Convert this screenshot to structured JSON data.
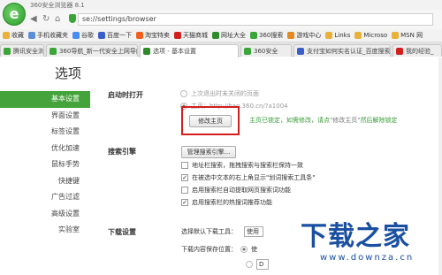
{
  "window": {
    "title": "360安全浏览器 8.1"
  },
  "address_bar": {
    "url": "se://settings/browser"
  },
  "bookmarks": [
    {
      "label": "收藏",
      "color": "#e9b13b"
    },
    {
      "label": "手机收藏夹",
      "color": "#5a8ed8"
    },
    {
      "label": "谷歌",
      "color": "#4a8df0"
    },
    {
      "label": "百度一下",
      "color": "#3a5fc8"
    },
    {
      "label": "淘宝特卖",
      "color": "#f06020"
    },
    {
      "label": "天猫商城",
      "color": "#d0201d"
    },
    {
      "label": "网址大全",
      "color": "#2f8a2c"
    },
    {
      "label": "360搜索",
      "color": "#3aa63a"
    },
    {
      "label": "游戏中心",
      "color": "#e08a20"
    },
    {
      "label": "Links",
      "color": "#e9b13b"
    },
    {
      "label": "Microso",
      "color": "#e9b13b"
    },
    {
      "label": "MSN 网",
      "color": "#e9b13b"
    }
  ],
  "tabs": [
    {
      "label": "腾讯安全浏览",
      "color": "#3aa63a"
    },
    {
      "label": "360导航_新一代安全上网导航",
      "color": "#3aa63a"
    },
    {
      "label": "选项 - 基本设置",
      "color": "#2f8a2c"
    },
    {
      "label": "360安全",
      "color": "#3aa63a"
    },
    {
      "label": "支付宝如何实名认证_百度搜索",
      "color": "#3a5fc8"
    },
    {
      "label": "我的经验_",
      "color": "#d0201d"
    }
  ],
  "page": {
    "title": "选项"
  },
  "sidebar": {
    "items": [
      {
        "label": "基本设置",
        "active": true
      },
      {
        "label": "界面设置",
        "active": false
      },
      {
        "label": "标签设置",
        "active": false
      },
      {
        "label": "优化加速",
        "active": false
      },
      {
        "label": "鼠标手势",
        "active": false
      },
      {
        "label": "快捷键",
        "active": false
      },
      {
        "label": "广告过滤",
        "active": false
      },
      {
        "label": "高级设置",
        "active": false
      },
      {
        "label": "实验室",
        "active": false
      }
    ]
  },
  "startup": {
    "label": "启动时打开",
    "option1": "上次退出时未关闭的页面",
    "option2": "主页：http://hao.360.cn/?a1004",
    "change_button": "修改主页",
    "note_locked": "主页已锁定，如需修改，请点",
    "note_link": "\"修改主页\"",
    "note_suffix": "然后解除锁定"
  },
  "search": {
    "label": "搜索引擎",
    "manage_button": "管理搜索引擎...",
    "options": [
      {
        "label": "地址栏搜索，拖拽搜索与搜索栏保持一致",
        "checked": false
      },
      {
        "label": "在被选中文本的右上角显示\"划词搜索工具条\"",
        "checked": true
      },
      {
        "label": "启用搜索栏自动提取网页搜索词功能",
        "checked": false
      },
      {
        "label": "启用搜索栏的热搜词推荐功能",
        "checked": true
      }
    ]
  },
  "download": {
    "label": "下载设置",
    "tool_label": "选择默认下载工具：",
    "tool_value": "使用",
    "location_label": "下载内容保存位置：",
    "location_value": "使",
    "location_value2": "D"
  },
  "watermark": {
    "main": "下载之家",
    "url": "www.downza.cn"
  }
}
